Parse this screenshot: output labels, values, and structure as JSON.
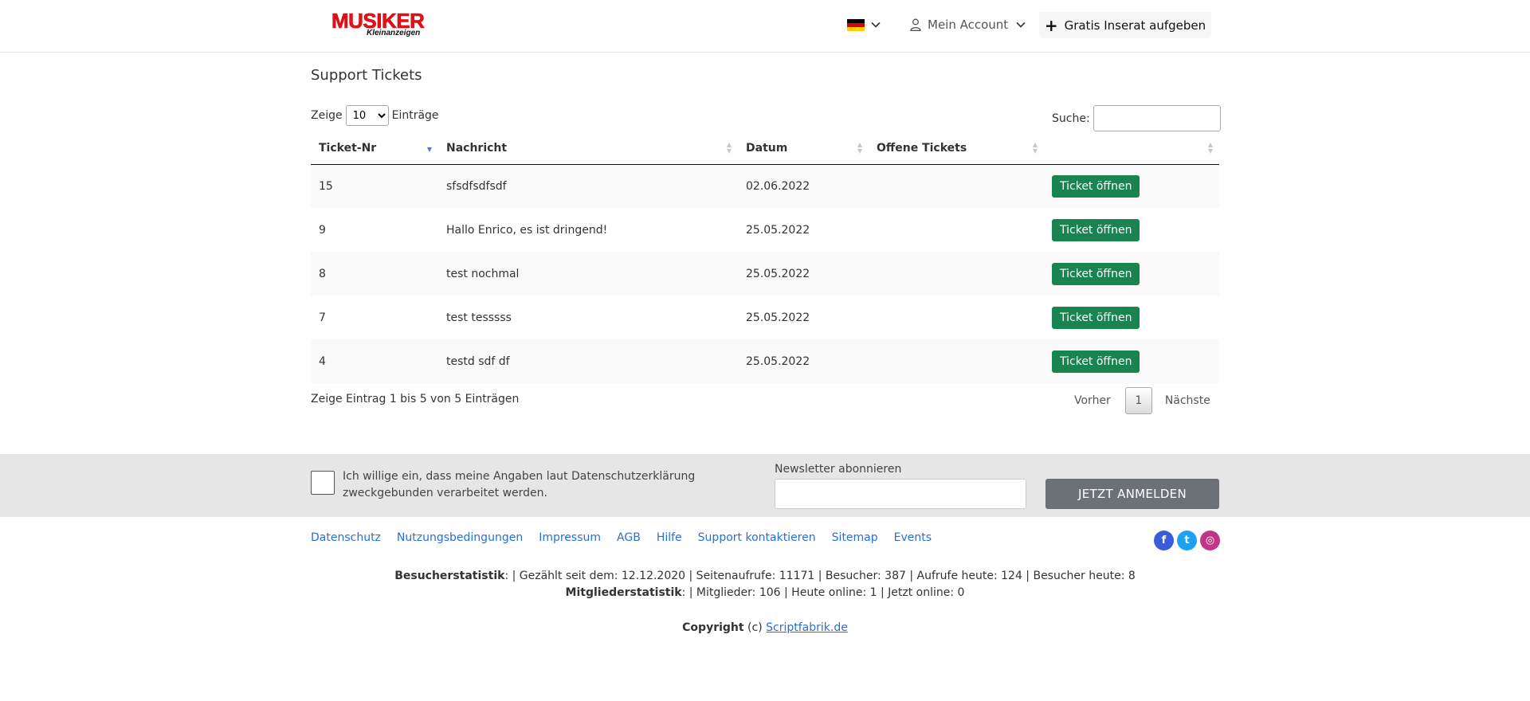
{
  "header": {
    "logo_main": "MUSIKER",
    "logo_sub": "Kleinanzeigen",
    "account_label": "Mein Account",
    "post_label": "Gratis Inserat aufgeben",
    "flag_colors": [
      "#000000",
      "#dd0000",
      "#ffce00"
    ]
  },
  "main": {
    "title": "Support Tickets",
    "length_prefix": "Zeige",
    "length_value": "10",
    "length_suffix": "Einträge",
    "search_label": "Suche:",
    "columns": [
      "Ticket-Nr",
      "Nachricht",
      "Datum",
      "Offene Tickets",
      ""
    ],
    "rows": [
      {
        "nr": "15",
        "msg": "sfsdfsdfsdf",
        "date": "02.06.2022",
        "open": "",
        "btn": "Ticket öffnen"
      },
      {
        "nr": "9",
        "msg": "Hallo Enrico, es ist dringend!",
        "date": "25.05.2022",
        "open": "",
        "btn": "Ticket öffnen"
      },
      {
        "nr": "8",
        "msg": "test nochmal",
        "date": "25.05.2022",
        "open": "",
        "btn": "Ticket öffnen"
      },
      {
        "nr": "7",
        "msg": "test tesssss",
        "date": "25.05.2022",
        "open": "",
        "btn": "Ticket öffnen"
      },
      {
        "nr": "4",
        "msg": "testd sdf df",
        "date": "25.05.2022",
        "open": "",
        "btn": "Ticket öffnen"
      }
    ],
    "info": "Zeige Eintrag 1 bis 5 von 5 Einträgen",
    "prev": "Vorher",
    "page": "1",
    "next": "Nächste"
  },
  "newsletter": {
    "consent": "Ich willige ein, dass meine Angaben laut Datenschutzerklärung zweckgebunden verarbeitet werden.",
    "label": "Newsletter abonnieren",
    "button": "JETZT ANMELDEN"
  },
  "footer": {
    "links": [
      "Datenschutz",
      "Nutzungsbedingungen",
      "Impressum",
      "AGB",
      "Hilfe",
      "Support kontaktieren",
      "Sitemap",
      "Events"
    ],
    "social": [
      {
        "name": "facebook-icon",
        "glyph": "f",
        "color": "#3b5bdb"
      },
      {
        "name": "twitter-icon",
        "glyph": "t",
        "color": "#1da1f2"
      },
      {
        "name": "instagram-icon",
        "glyph": "◎",
        "color": "#c13584"
      }
    ],
    "visitor_label": "Besucherstatistik",
    "visitor_text": ":  |  Gezählt seit dem: 12.12.2020 | Seitenaufrufe: 11171 | Besucher: 387 | Aufrufe heute: 124 | Besucher heute: 8",
    "member_label": "Mitgliederstatistik",
    "member_text": ":  |  Mitglieder: 106 | Heute online: 1 | Jetzt online: 0",
    "copyright_prefix": "Copyright",
    "copyright_mid": " (c) ",
    "copyright_link": "Scriptfabrik.de"
  }
}
